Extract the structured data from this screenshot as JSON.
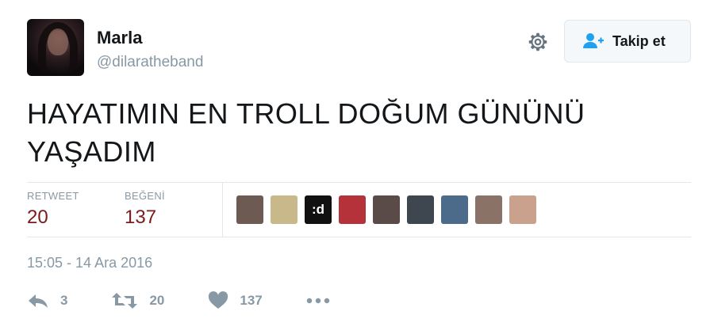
{
  "user": {
    "display_name": "Marla",
    "screen_name": "@dilaratheband"
  },
  "follow_button": {
    "label": "Takip et",
    "icon": "add-user-icon"
  },
  "settings_icon": "gear-icon",
  "tweet": {
    "text_line1": "HAYATIMIN EN TROLL DOĞUM GÜNÜNÜ",
    "text_line2": "YAŞADIM",
    "timestamp": "15:05 - 14 Ara 2016"
  },
  "stats": {
    "retweet_label": "RETWEET",
    "retweet_value": "20",
    "like_label": "BEĞENİ",
    "like_value": "137"
  },
  "likers": [
    {
      "name": "liker-avatar-1",
      "color": "#6d5a52"
    },
    {
      "name": "liker-avatar-2",
      "color": "#c9b98a"
    },
    {
      "name": "liker-avatar-3",
      "color": "#111111",
      "text": ":d"
    },
    {
      "name": "liker-avatar-4",
      "color": "#b5323a"
    },
    {
      "name": "liker-avatar-5",
      "color": "#5a4a48"
    },
    {
      "name": "liker-avatar-6",
      "color": "#3e4650"
    },
    {
      "name": "liker-avatar-7",
      "color": "#4c6a8a"
    },
    {
      "name": "liker-avatar-8",
      "color": "#8a7366"
    },
    {
      "name": "liker-avatar-9",
      "color": "#c9a18c"
    }
  ],
  "actions": {
    "reply_count": "3",
    "retweet_count": "20",
    "like_count": "137"
  },
  "colors": {
    "accent": "#1da1f2",
    "stat_value": "#7d1a1a",
    "muted": "#8899a6"
  }
}
